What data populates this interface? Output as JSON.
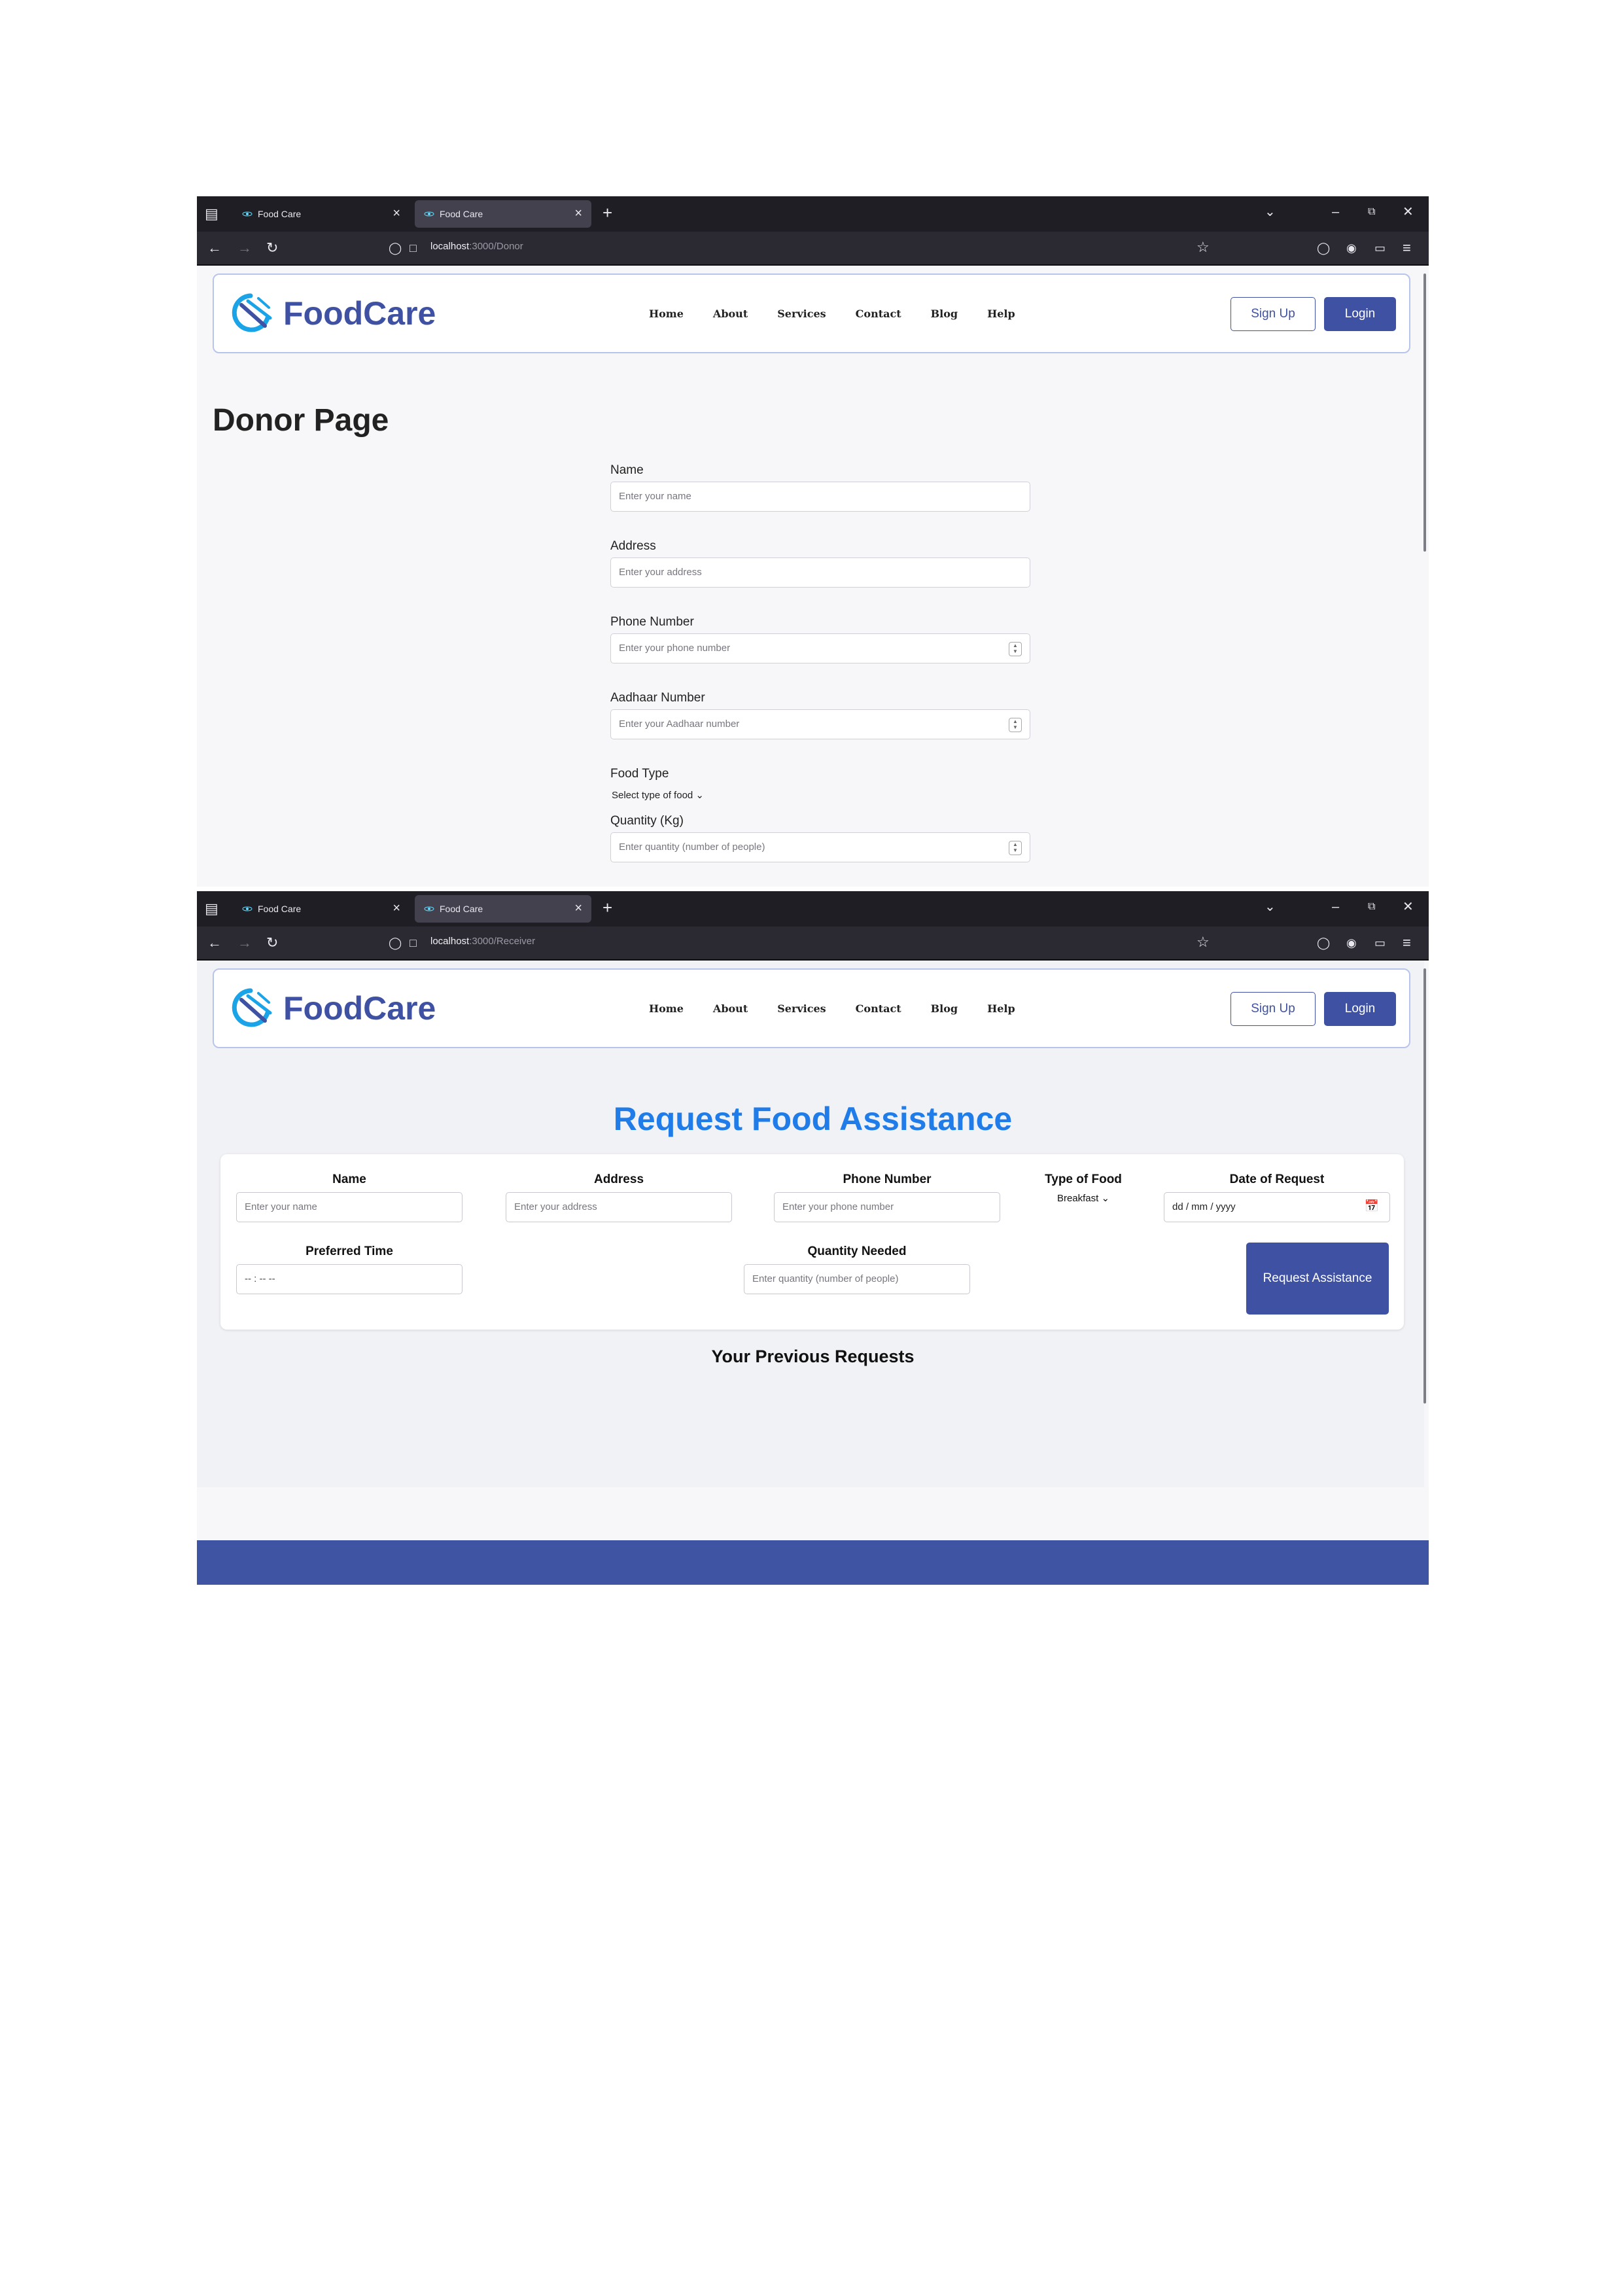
{
  "browser": {
    "tabs": [
      "Food Care",
      "Food Care"
    ],
    "donor_url_host": "localhost",
    "donor_url_path": ":3000/Donor",
    "receiver_url_host": "localhost",
    "receiver_url_path": ":3000/Receiver"
  },
  "site": {
    "brand": "FoodCare",
    "nav": [
      "Home",
      "About",
      "Services",
      "Contact",
      "Blog",
      "Help"
    ],
    "signup_label": "Sign Up",
    "login_label": "Login"
  },
  "donor": {
    "title": "Donor Page",
    "fields": {
      "name": {
        "label": "Name",
        "placeholder": "Enter your name"
      },
      "address": {
        "label": "Address",
        "placeholder": "Enter your address"
      },
      "phone": {
        "label": "Phone Number",
        "placeholder": "Enter your phone number"
      },
      "aadhaar": {
        "label": "Aadhaar Number",
        "placeholder": "Enter your Aadhaar number"
      },
      "food_type": {
        "label": "Food Type",
        "value": "Select type of food"
      },
      "quantity": {
        "label": "Quantity (Kg)",
        "placeholder": "Enter quantity (number of people)"
      }
    }
  },
  "receiver": {
    "title": "Request Food Assistance",
    "fields": {
      "name": {
        "label": "Name",
        "placeholder": "Enter your name"
      },
      "address": {
        "label": "Address",
        "placeholder": "Enter your address"
      },
      "phone": {
        "label": "Phone Number",
        "placeholder": "Enter your phone number"
      },
      "food_type": {
        "label": "Type of Food",
        "value": "Breakfast"
      },
      "date": {
        "label": "Date of Request",
        "placeholder": "dd / mm / yyyy"
      },
      "time": {
        "label": "Preferred Time",
        "placeholder": "-- : --   --"
      },
      "quantity": {
        "label": "Quantity Needed",
        "placeholder": "Enter quantity (number of people)"
      }
    },
    "submit_label": "Request Assistance",
    "previous_title": "Your Previous Requests"
  },
  "colors": {
    "brand": "#3f51a2",
    "title_blue": "#1f7ce8",
    "footer": "#3f55a4"
  }
}
